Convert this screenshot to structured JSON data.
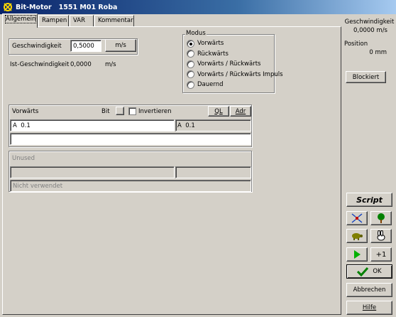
{
  "window": {
    "title": "Bit-Motor   1551 M01 Roba"
  },
  "tabs": [
    {
      "label": "Allgemein"
    },
    {
      "label": "Rampen"
    },
    {
      "label": "VAR"
    },
    {
      "label": "Kommentar"
    }
  ],
  "speed": {
    "label": "Geschwindigkeit",
    "value": "0,5000",
    "unit_button": "m/s",
    "actual_label": "Ist-Geschwindigkeit",
    "actual_value": "0,0000",
    "actual_unit": "m/s"
  },
  "modus": {
    "title": "Modus",
    "options": [
      {
        "label": "Vorwärts",
        "checked": true
      },
      {
        "label": "Rückwärts",
        "checked": false
      },
      {
        "label": "Vorwärts / Rückwärts",
        "checked": false
      },
      {
        "label": "Vorwärts / Rückwärts Impuls",
        "checked": false
      },
      {
        "label": "Dauernd",
        "checked": false
      }
    ]
  },
  "forward": {
    "title": "Vorwärts",
    "bit_label": "Bit",
    "invert_label": "Invertieren",
    "ql_button": "QL",
    "adr_button": "Adr",
    "address_value": "A  0.1",
    "address_display": "A  0.1",
    "comment_value": ""
  },
  "unused": {
    "title": "Unused",
    "note": "Nicht verwendet"
  },
  "side": {
    "speed_label": "Geschwindigkeit",
    "speed_value": "0,0000 m/s",
    "position_label": "Position",
    "position_value": "0 mm",
    "blocked_button": "Blockiert",
    "script_button": "Script",
    "plusone_button": "+1",
    "ok_button": "OK",
    "cancel_button": "Abbrechen",
    "help_button": "Hilfe"
  },
  "colors": {
    "title_gradient_start": "#0a246a",
    "title_gradient_end": "#a6caf0",
    "face": "#d4d0c8",
    "play_green": "#00b000",
    "ok_check_green": "#008000"
  }
}
